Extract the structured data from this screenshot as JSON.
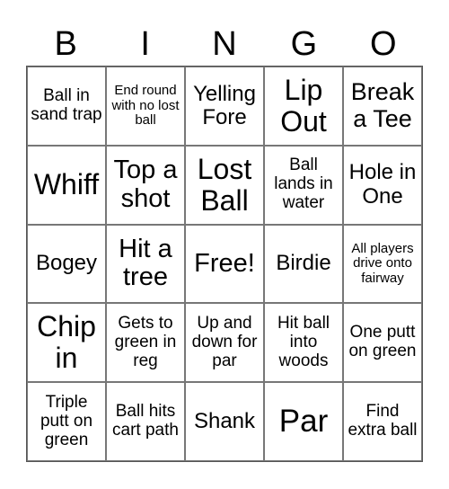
{
  "header": [
    "B",
    "I",
    "N",
    "G",
    "O"
  ],
  "cells": [
    "Ball in sand trap",
    "End round with no lost ball",
    "Yelling Fore",
    "Lip Out",
    "Break a Tee",
    "Whiff",
    "Top a shot",
    "Lost Ball",
    "Ball lands in water",
    "Hole in One",
    "Bogey",
    "Hit a tree",
    "Free!",
    "Birdie",
    "All players drive onto fairway",
    "Chip in",
    "Gets to green in reg",
    "Up and down for par",
    "Hit ball into woods",
    "One putt on green",
    "Triple putt on green",
    "Ball hits cart path",
    "Shank",
    "Par",
    "Find extra ball"
  ]
}
